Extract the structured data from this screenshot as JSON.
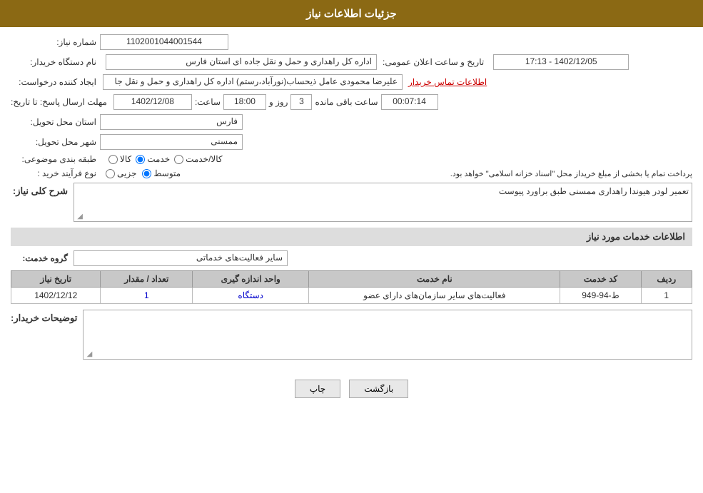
{
  "header": {
    "title": "جزئیات اطلاعات نیاز"
  },
  "fields": {
    "id_label": "شماره نیاز:",
    "id_value": "1102001044001544",
    "buyer_name_label": "نام دستگاه خریدار:",
    "buyer_name_value": "اداره کل راهداری و حمل و نقل جاده ای استان فارس",
    "creator_label": "ایجاد کننده درخواست:",
    "creator_value": "علیرضا محمودی عامل ذیحساب(نورآباد،رستم) اداره کل راهداری و حمل و نقل جا",
    "creator_link": "اطلاعات تماس خریدار",
    "deadline_label": "مهلت ارسال پاسخ: تا تاریخ:",
    "deadline_date": "1402/12/08",
    "deadline_time_label": "ساعت:",
    "deadline_time": "18:00",
    "deadline_day_label": "روز و",
    "deadline_days": "3",
    "deadline_remaining_label": "ساعت باقی مانده",
    "deadline_remaining": "00:07:14",
    "announce_label": "تاریخ و ساعت اعلان عمومی:",
    "announce_value": "1402/12/05 - 17:13",
    "province_label": "استان محل تحویل:",
    "province_value": "فارس",
    "city_label": "شهر محل تحویل:",
    "city_value": "ممسنی",
    "category_label": "طبقه بندی موضوعی:",
    "category_options": [
      {
        "value": "kala",
        "label": "کالا"
      },
      {
        "value": "khadamat",
        "label": "خدمت"
      },
      {
        "value": "kala_khadamat",
        "label": "کالا/خدمت"
      }
    ],
    "category_selected": "khadamat",
    "purchase_type_label": "نوع فرآیند خرید :",
    "purchase_type_options": [
      {
        "value": "jozi",
        "label": "جزیی"
      },
      {
        "value": "motavaset",
        "label": "متوسط"
      }
    ],
    "purchase_type_selected": "motavaset",
    "purchase_note": "پرداخت تمام یا بخشی از مبلغ خریداز محل \"اسناد خزانه اسلامی\" خواهد بود.",
    "description_label": "شرح کلی نیاز:",
    "description_value": "تعمیر لودر هیوندا راهداری ممسنی طبق براورد پیوست",
    "service_info_title": "اطلاعات خدمات مورد نیاز",
    "service_group_label": "گروه خدمت:",
    "service_group_value": "سایر فعالیت‌های خدماتی",
    "table": {
      "headers": [
        "ردیف",
        "کد خدمت",
        "نام خدمت",
        "واحد اندازه گیری",
        "تعداد / مقدار",
        "تاریخ نیاز"
      ],
      "rows": [
        {
          "row": "1",
          "code": "ط-94-949",
          "name": "فعالیت‌های سایر سازمان‌های دارای عضو",
          "unit": "دستگاه",
          "count": "1",
          "date": "1402/12/12"
        }
      ]
    },
    "buyer_desc_label": "توضیحات خریدار:",
    "buyer_desc_value": ""
  },
  "buttons": {
    "print": "چاپ",
    "back": "بازگشت"
  }
}
